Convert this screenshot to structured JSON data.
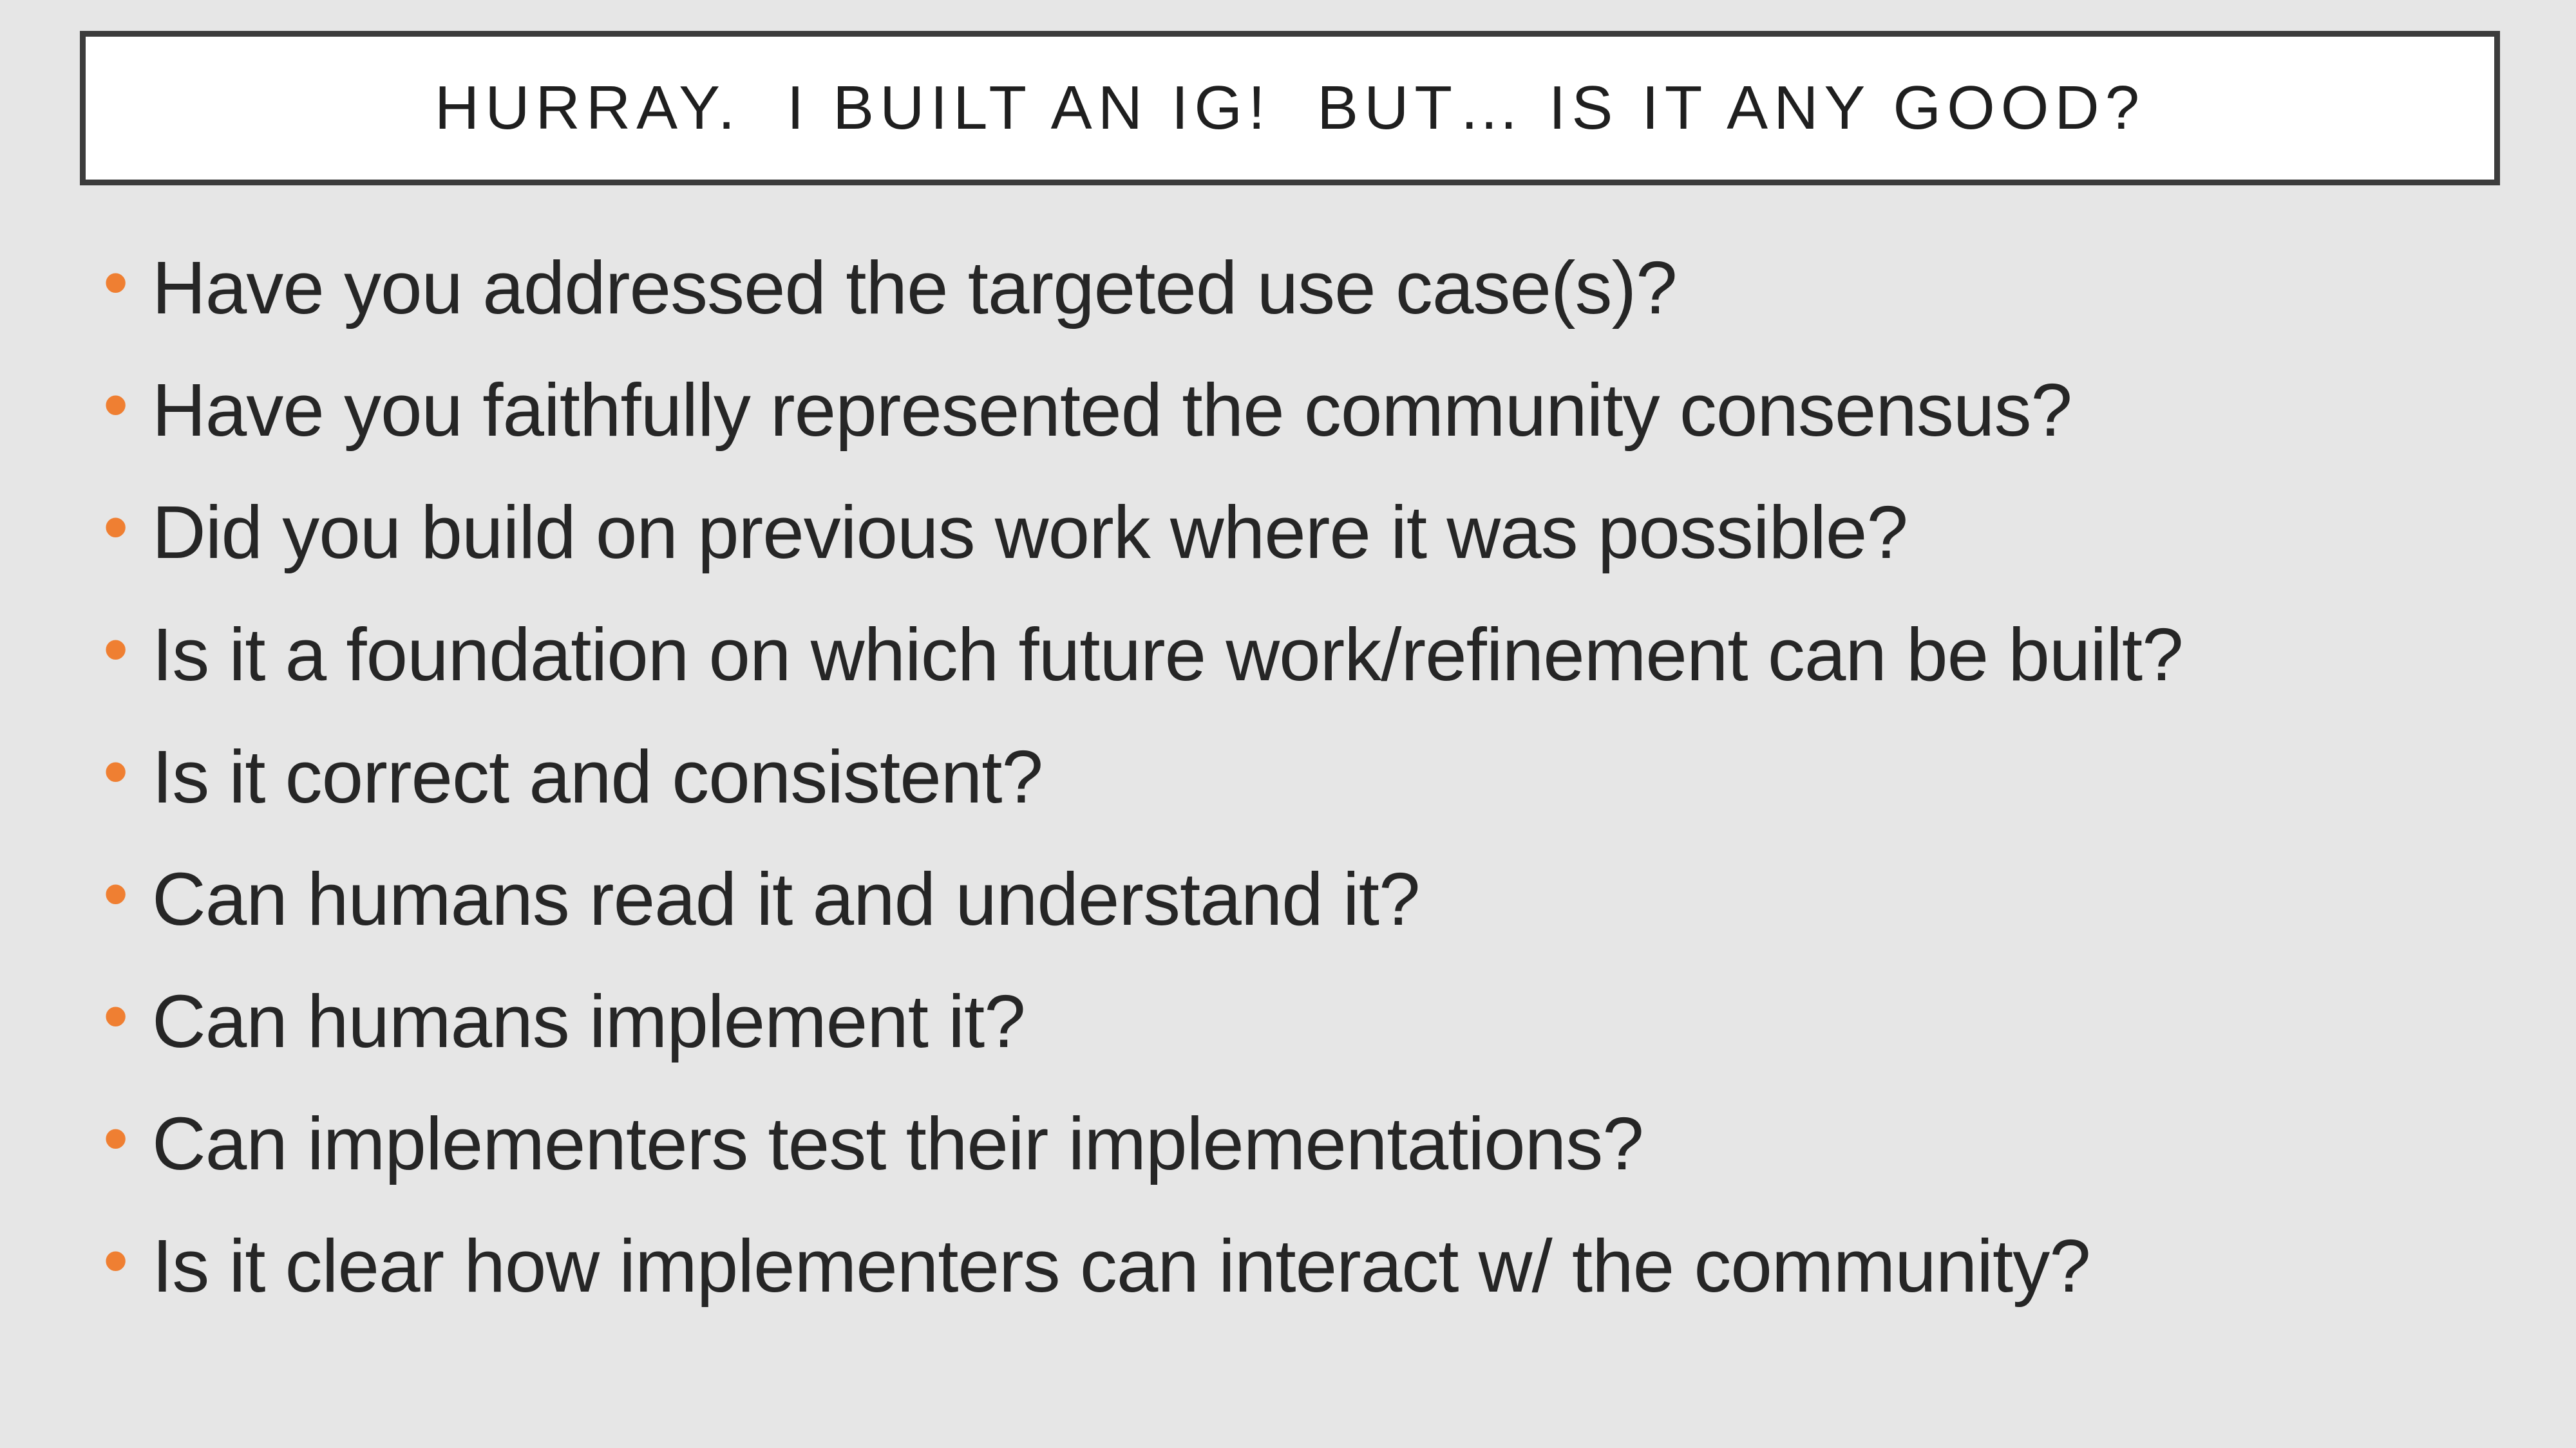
{
  "slide": {
    "title": "HURRAY.  I BUILT AN IG!  BUT… IS IT ANY GOOD?",
    "bullet_glyph": "•",
    "accent_color": "#ef7f32",
    "bullets": [
      "Have you addressed the targeted use case(s)?",
      "Have you faithfully represented the community consensus?",
      "Did you build on previous work where it was possible?",
      "Is it a foundation on which future work/refinement can be built?",
      "Is it correct and consistent?",
      "Can humans read it and understand it?",
      "Can humans implement it?",
      "Can implementers test their implementations?",
      "Is it clear how implementers can interact w/ the community?"
    ]
  }
}
